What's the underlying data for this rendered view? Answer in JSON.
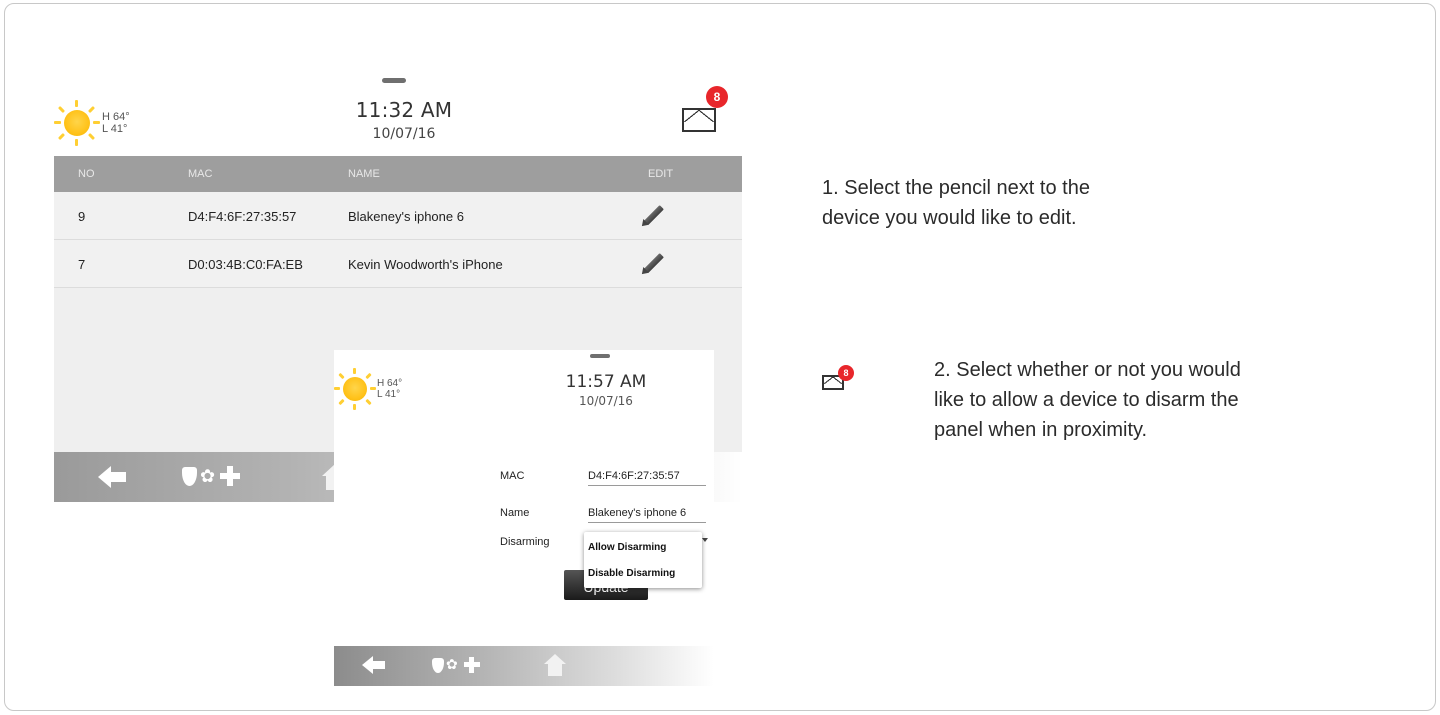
{
  "screen1": {
    "weather": {
      "high": "H 64°",
      "low": "L 41°",
      "icon": "sun-icon"
    },
    "clock": {
      "time": "11:32 AM",
      "date": "10/07/16"
    },
    "messages": {
      "count": "8",
      "icon": "envelope-icon"
    },
    "table": {
      "headers": {
        "no": "NO",
        "mac": "MAC",
        "name": "NAME",
        "edit": "EDIT"
      },
      "rows": [
        {
          "no": "9",
          "mac": "D4:F4:6F:27:35:57",
          "name": "Blakeney's iphone 6"
        },
        {
          "no": "7",
          "mac": "D0:03:4B:C0:FA:EB",
          "name": "Kevin Woodworth's iPhone"
        }
      ]
    },
    "nav_icons": [
      "back-arrow-icon",
      "shield-icon",
      "flame-icon",
      "plus-icon",
      "home-icon"
    ]
  },
  "screen2": {
    "weather": {
      "high": "H 64°",
      "low": "L 41°",
      "icon": "sun-icon"
    },
    "clock": {
      "time": "11:57 AM",
      "date": "10/07/16"
    },
    "form": {
      "mac_label": "MAC",
      "mac_value": "D4:F4:6F:27:35:57",
      "name_label": "Name",
      "name_value": "Blakeney's iphone 6",
      "disarming_label": "Disarming",
      "disarming_options": [
        "Allow Disarming",
        "Disable Disarming"
      ],
      "update_label": "Update"
    }
  },
  "instructions": {
    "step1": "1. Select the pencil next to the device you would like to edit.",
    "step1_line1": "1. Select the pencil next to the",
    "step1_line2": "device you would like to edit.",
    "step2_line1": "2. Select whether or not you would",
    "step2_line2": "like to allow a device to disarm the",
    "step2_line3": "panel when in proximity.",
    "side_badge": "8"
  },
  "colors": {
    "badge": "#e8262b",
    "header_bar": "#9e9e9e",
    "sun": "#ffc21a"
  }
}
